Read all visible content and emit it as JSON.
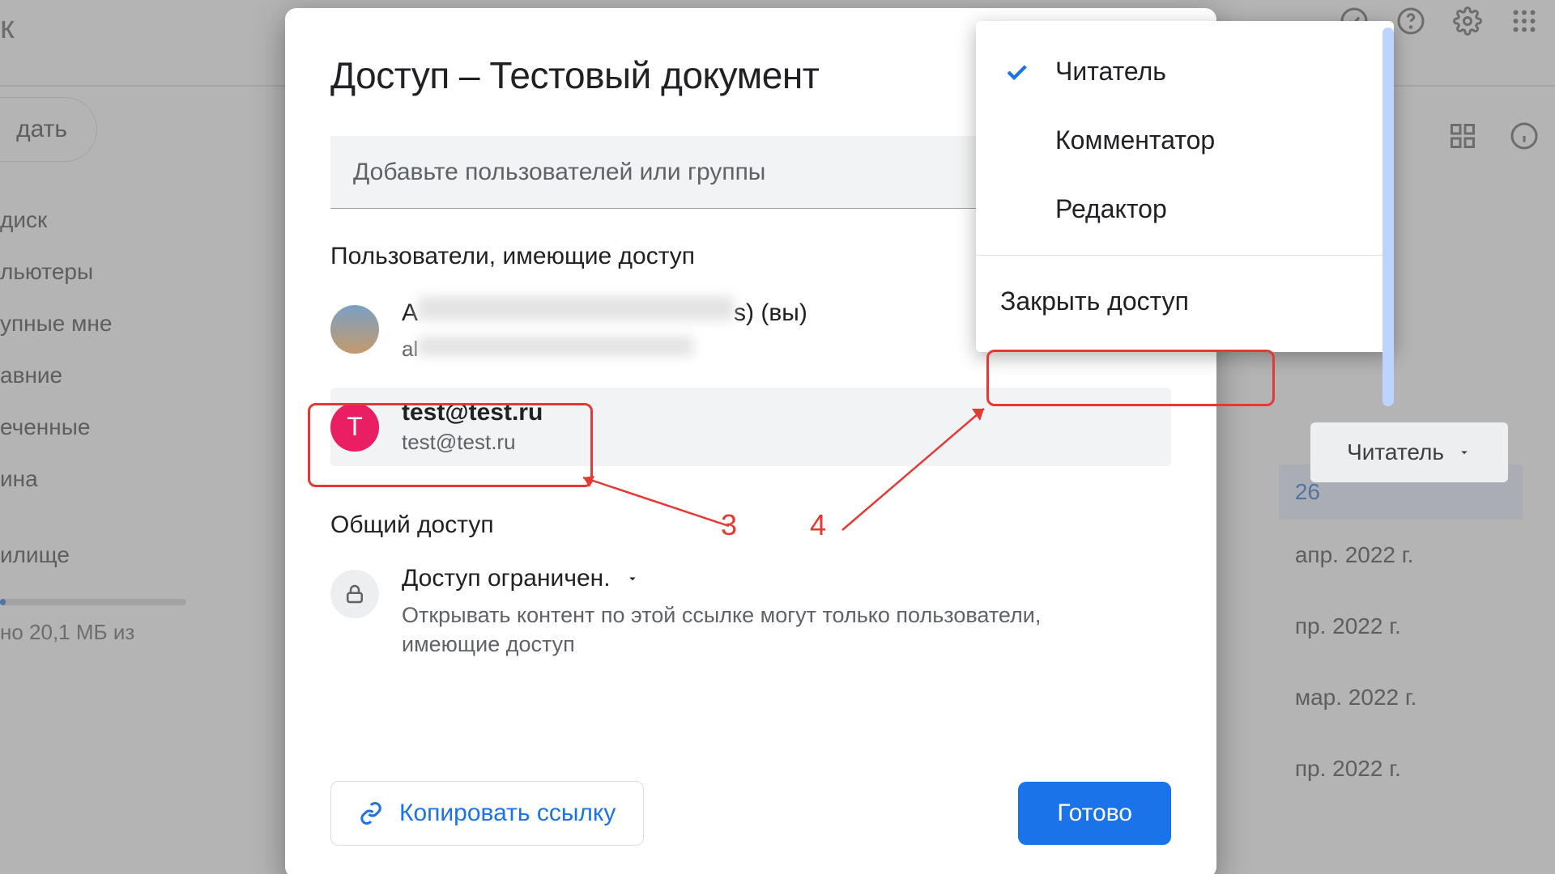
{
  "bg": {
    "logo_fragment": "ск",
    "new_button": "дать",
    "sidebar_items": [
      "диск",
      "льютеры",
      "упные мне",
      "авние",
      "еченные",
      "ина",
      "илище"
    ],
    "storage_text": "но 20,1 МБ из",
    "row_selected_fragment": "26",
    "rows": [
      "апр. 2022 г.",
      "пр. 2022 г.",
      "мар. 2022 г.",
      "пр. 2022 г."
    ]
  },
  "modal": {
    "title": "Доступ – Тестовый документ",
    "input_placeholder": "Добавьте пользователей или группы",
    "section_users": "Пользователи, имеющие доступ",
    "owner": {
      "name_prefix": "A",
      "name_suffix": "s) (вы)",
      "email_prefix": "al"
    },
    "user2": {
      "name": "test@test.ru",
      "email": "test@test.ru",
      "avatar_letter": "T",
      "role": "Читатель"
    },
    "section_general": "Общий доступ",
    "general_title": "Доступ ограничен.",
    "general_desc": "Открывать контент по этой ссылке могут только пользователи, имеющие доступ",
    "copy_link": "Копировать ссылку",
    "done": "Готово"
  },
  "dropdown": {
    "items": [
      "Читатель",
      "Комментатор",
      "Редактор"
    ],
    "selected_index": 0,
    "remove": "Закрыть доступ"
  },
  "annotations": {
    "n3": "3",
    "n4": "4"
  }
}
